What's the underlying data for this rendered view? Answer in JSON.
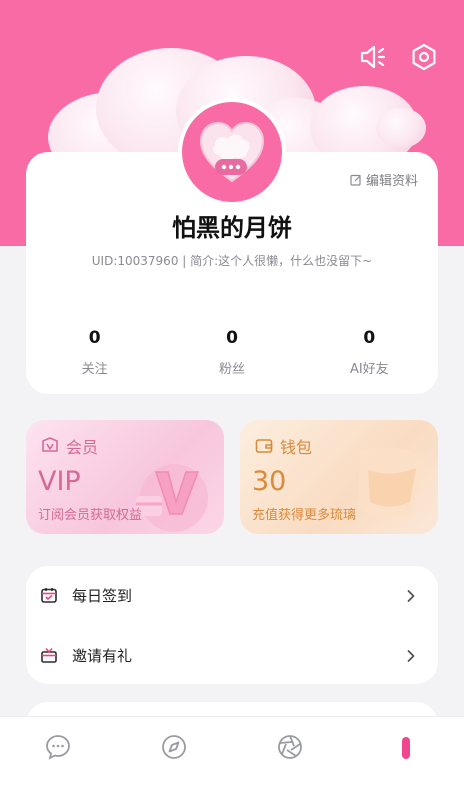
{
  "header": {
    "sound_icon": "speaker-icon",
    "settings_icon": "gear-icon"
  },
  "profile": {
    "edit_label": "编辑资料",
    "username": "怕黑的月饼",
    "bio": "UID:10037960 | 简介:这个人很懒，什么也没留下~",
    "stats": [
      {
        "value": "0",
        "label": "关注"
      },
      {
        "value": "0",
        "label": "粉丝"
      },
      {
        "value": "0",
        "label": "AI好友"
      }
    ]
  },
  "vip": {
    "title": "会员",
    "big": "VIP",
    "subtitle": "订阅会员获取权益"
  },
  "wallet": {
    "title": "钱包",
    "big": "30",
    "subtitle": "充值获得更多琉璃"
  },
  "menu": [
    {
      "label": "每日签到",
      "icon": "calendar-icon"
    },
    {
      "label": "邀请有礼",
      "icon": "gift-icon"
    }
  ],
  "tabs": [
    {
      "icon": "chat-icon"
    },
    {
      "icon": "compass-icon"
    },
    {
      "icon": "aperture-icon"
    },
    {
      "icon": "profile-icon",
      "active": true
    }
  ],
  "colors": {
    "brand_pink": "#f96ba4",
    "vip_text": "#d46a97",
    "wallet_text": "#d98a3a"
  }
}
